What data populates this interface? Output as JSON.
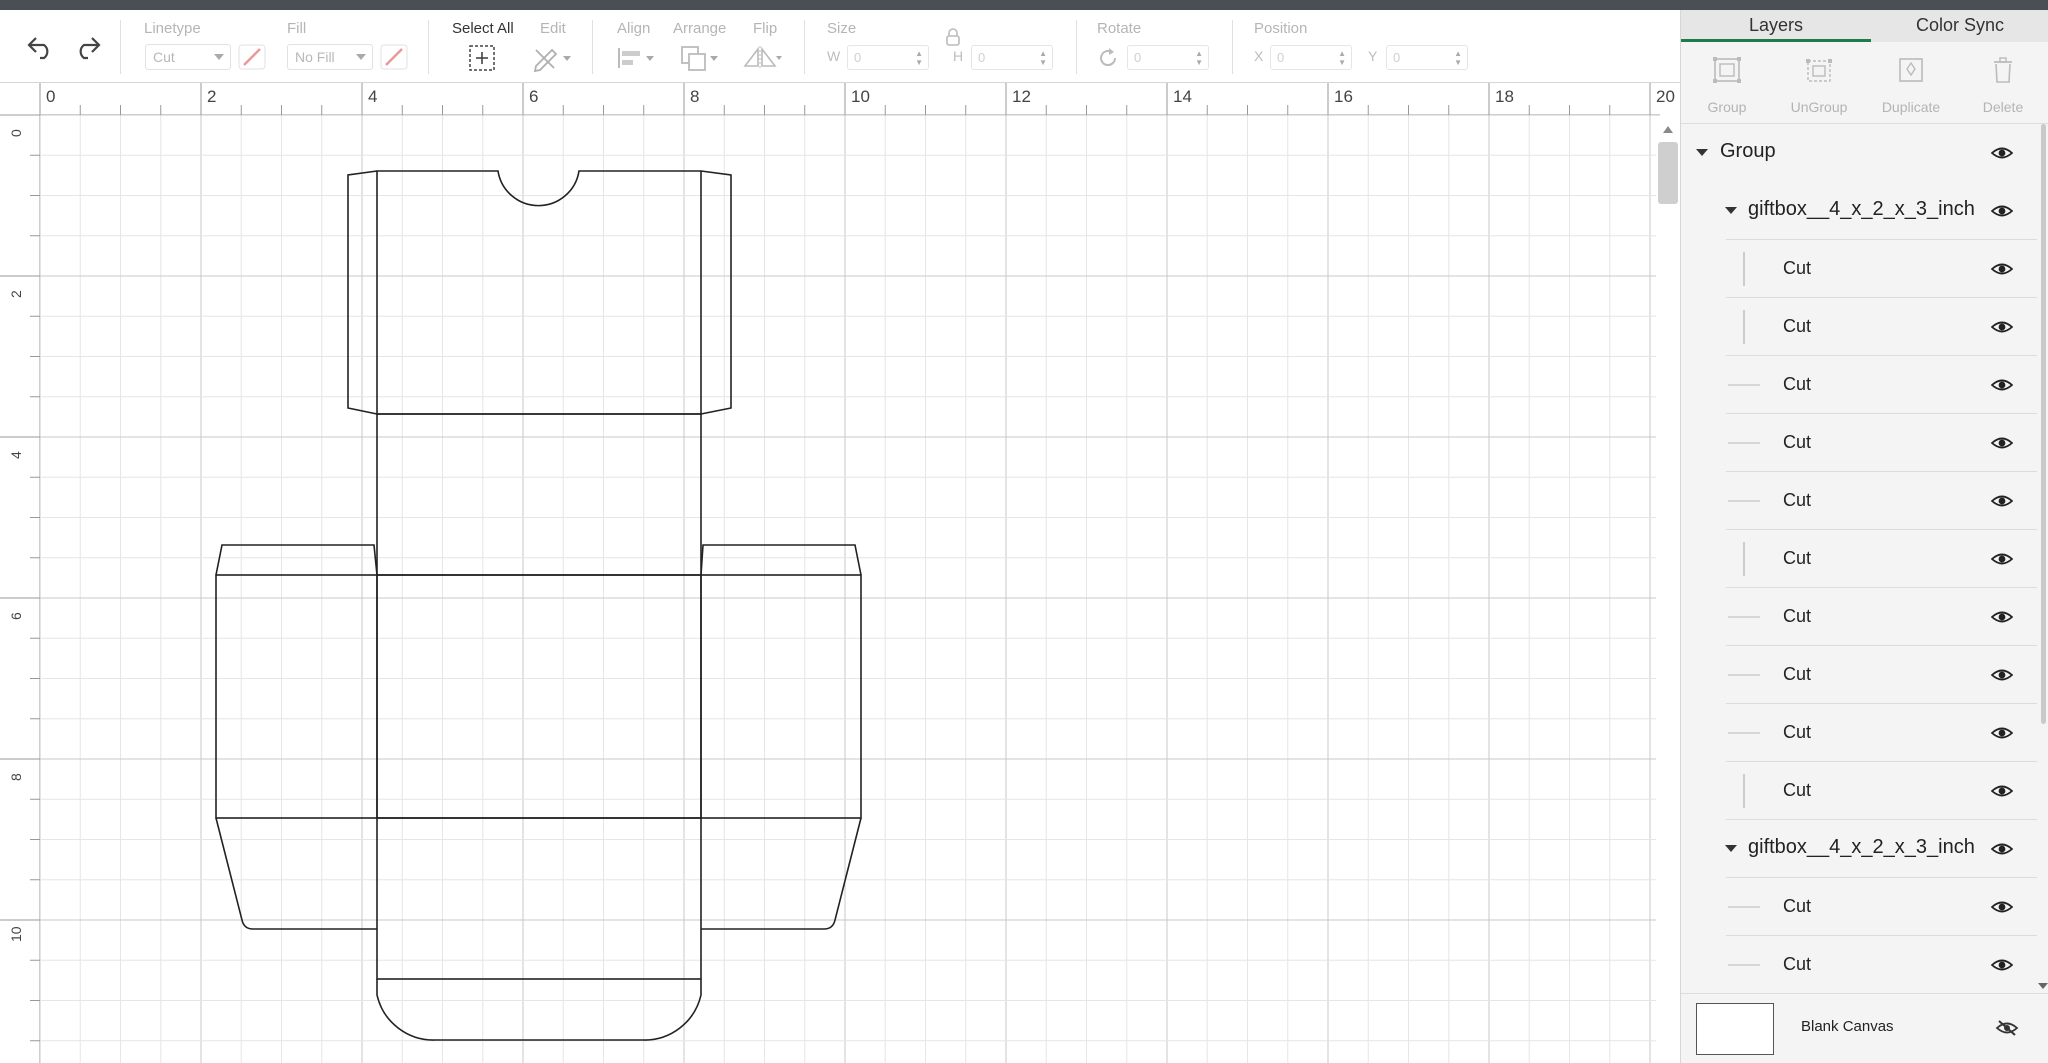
{
  "toolbar": {
    "linetype_label": "Linetype",
    "linetype_value": "Cut",
    "fill_label": "Fill",
    "fill_value": "No Fill",
    "select_all_label": "Select All",
    "edit_label": "Edit",
    "align_label": "Align",
    "arrange_label": "Arrange",
    "flip_label": "Flip",
    "size_label": "Size",
    "w_label": "W",
    "w_value": "0",
    "h_label": "H",
    "h_value": "0",
    "rotate_label": "Rotate",
    "rotate_value": "0",
    "position_label": "Position",
    "x_label": "X",
    "x_value": "0",
    "y_label": "Y",
    "y_value": "0"
  },
  "ruler": {
    "top": [
      "0",
      "2",
      "4",
      "6",
      "8",
      "10",
      "12",
      "14",
      "16",
      "18",
      "20"
    ],
    "left": [
      "0",
      "2",
      "4",
      "6",
      "8",
      "10"
    ]
  },
  "panel": {
    "tabs": [
      "Layers",
      "Color Sync"
    ],
    "actions": [
      "Group",
      "UnGroup",
      "Duplicate",
      "Delete"
    ],
    "layers": [
      {
        "kind": "group",
        "name": "Group"
      },
      {
        "kind": "sub",
        "name": "giftbox__4_x_2_x_3_inch"
      },
      {
        "kind": "cut",
        "name": "Cut",
        "thumb": "vertical"
      },
      {
        "kind": "cut",
        "name": "Cut",
        "thumb": "vertical"
      },
      {
        "kind": "cut",
        "name": "Cut",
        "thumb": "horizontal"
      },
      {
        "kind": "cut",
        "name": "Cut",
        "thumb": "horizontal"
      },
      {
        "kind": "cut",
        "name": "Cut",
        "thumb": "horizontal"
      },
      {
        "kind": "cut",
        "name": "Cut",
        "thumb": "vertical"
      },
      {
        "kind": "cut",
        "name": "Cut",
        "thumb": "horizontal"
      },
      {
        "kind": "cut",
        "name": "Cut",
        "thumb": "horizontal"
      },
      {
        "kind": "cut",
        "name": "Cut",
        "thumb": "horizontal"
      },
      {
        "kind": "cut",
        "name": "Cut",
        "thumb": "vertical"
      },
      {
        "kind": "sub",
        "name": "giftbox__4_x_2_x_3_inch"
      },
      {
        "kind": "cut",
        "name": "Cut",
        "thumb": "horizontal"
      },
      {
        "kind": "cut",
        "name": "Cut",
        "thumb": "horizontal"
      }
    ],
    "blank_canvas": "Blank Canvas"
  },
  "colors": {
    "accent_tab": "#1f7a4c",
    "linetype_swatch": "#e89a9a",
    "cut_line": "#222222"
  }
}
